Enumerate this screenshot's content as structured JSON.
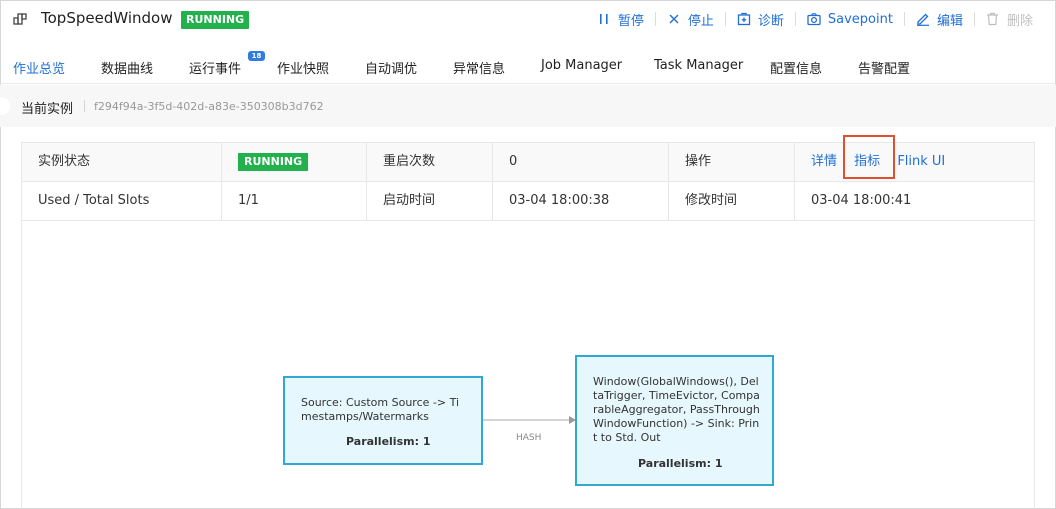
{
  "header": {
    "title": "TopSpeedWindow",
    "status": "RUNNING",
    "actions": [
      {
        "label": "暂停",
        "icon": "pause-icon"
      },
      {
        "label": "停止",
        "icon": "stop-icon"
      },
      {
        "label": "诊断",
        "icon": "diagnose-icon"
      },
      {
        "label": "Savepoint",
        "icon": "camera-icon"
      },
      {
        "label": "编辑",
        "icon": "edit-icon"
      },
      {
        "label": "删除",
        "icon": "trash-icon"
      }
    ]
  },
  "tabs": [
    {
      "label": "作业总览"
    },
    {
      "label": "数据曲线"
    },
    {
      "label": "运行事件",
      "badge": "18"
    },
    {
      "label": "作业快照"
    },
    {
      "label": "自动调优"
    },
    {
      "label": "异常信息"
    },
    {
      "label": "Job Manager"
    },
    {
      "label": "Task Manager"
    },
    {
      "label": "配置信息"
    },
    {
      "label": "告警配置"
    }
  ],
  "instance": {
    "label": "当前实例",
    "id": "f294f94a-3f5d-402d-a83e-350308b3d762"
  },
  "info": {
    "state_label": "实例状态",
    "state_value": "RUNNING",
    "restart_label": "重启次数",
    "restart_value": "0",
    "ops_label": "操作",
    "ops_links": [
      "详情",
      "指标",
      "Flink UI"
    ],
    "slots_label": "Used / Total Slots",
    "slots_value": "1/1",
    "start_label": "启动时间",
    "start_value": "03-04 18:00:38",
    "modify_label": "修改时间",
    "modify_value": "03-04 18:00:41"
  },
  "dag": {
    "source": {
      "text": "Source: Custom Source -> Timestamps/Watermarks",
      "parallelism": "Parallelism: 1"
    },
    "sink": {
      "text": "Window(GlobalWindows(), DeltaTrigger, TimeEvictor, ComparableAggregator, PassThroughWindowFunction) -> Sink: Print to Std. Out",
      "parallelism": "Parallelism: 1"
    },
    "edge_label": "HASH"
  },
  "colors": {
    "accent": "#1f6fd6",
    "running": "#22b14c",
    "node_fill": "#e6f7fd",
    "node_border": "#31a7d3",
    "highlight": "#e0502f"
  }
}
